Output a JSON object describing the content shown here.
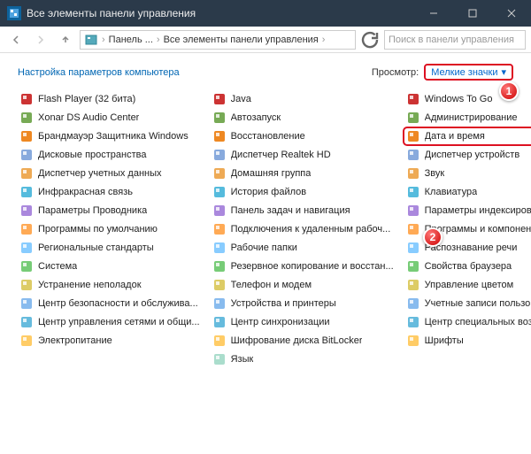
{
  "titlebar": {
    "title": "Все элементы панели управления"
  },
  "breadcrumb": {
    "a": "Панель ...",
    "b": "Все элементы панели управления"
  },
  "search": {
    "placeholder": "Поиск в панели управления"
  },
  "heading": "Настройка параметров компьютера",
  "view": {
    "label": "Просмотр:",
    "value": "Мелкие значки"
  },
  "badges": {
    "one": "1",
    "two": "2"
  },
  "cols": {
    "c1": [
      "Flash Player (32 бита)",
      "Xonar DS Audio Center",
      "Брандмауэр Защитника Windows",
      "Дисковые пространства",
      "Диспетчер учетных данных",
      "Инфракрасная связь",
      "Параметры Проводника",
      "Программы по умолчанию",
      "Региональные стандарты",
      "Система",
      "Устранение неполадок",
      "Центр безопасности и обслужива...",
      "Центр управления сетями и общи...",
      "Электропитание"
    ],
    "c2": [
      "Java",
      "Автозапуск",
      "Восстановление",
      "Диспетчер Realtek HD",
      "Домашняя группа",
      "История файлов",
      "Панель задач и навигация",
      "Подключения к удаленным рабоч...",
      "Рабочие папки",
      "Резервное копирование и восстан...",
      "Телефон и модем",
      "Устройства и принтеры",
      "Центр синхронизации",
      "Шифрование диска BitLocker",
      "Язык"
    ],
    "c3": [
      "Windows To Go",
      "Администрирование",
      "Дата и время",
      "Диспетчер устройств",
      "Звук",
      "Клавиатура",
      "Параметры индексирования",
      "Программы и компоненты",
      "Распознавание речи",
      "Свойства браузера",
      "Управление цветом",
      "Учетные записи пользователей",
      "Центр специальных возможностей",
      "Шрифты"
    ]
  }
}
